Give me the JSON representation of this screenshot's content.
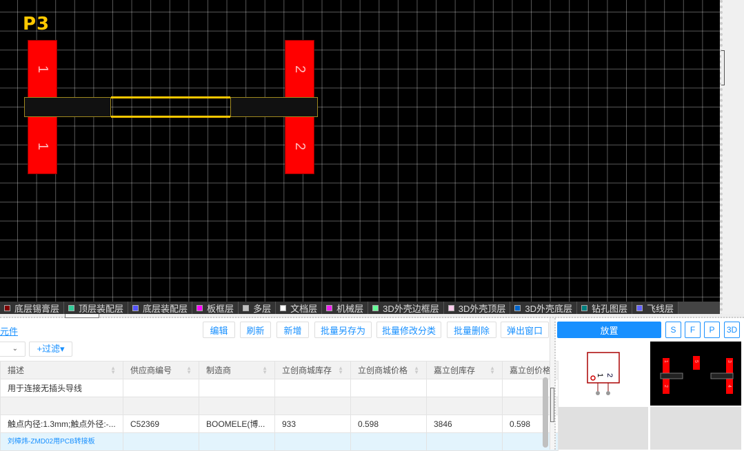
{
  "canvas": {
    "designator": "P3",
    "pads": [
      {
        "number": "1"
      },
      {
        "number": "1"
      },
      {
        "number": "2"
      },
      {
        "number": "2"
      }
    ]
  },
  "layers": [
    {
      "label": "底层锡膏层",
      "color": "#800000"
    },
    {
      "label": "顶层装配层",
      "color": "#33cc99"
    },
    {
      "label": "底层装配层",
      "color": "#5555ff"
    },
    {
      "label": "板框层",
      "color": "#ff00ff"
    },
    {
      "label": "多层",
      "color": "#c0c0c0"
    },
    {
      "label": "文档层",
      "color": "#ffffff"
    },
    {
      "label": "机械层",
      "color": "#f022f0"
    },
    {
      "label": "3D外壳边框层",
      "color": "#66ff99"
    },
    {
      "label": "3D外壳顶层",
      "color": "#ffccee"
    },
    {
      "label": "3D外壳底层",
      "color": "#0066cc"
    },
    {
      "label": "钻孔图层",
      "color": "#008080"
    },
    {
      "label": "飞线层",
      "color": "#6464ff"
    }
  ],
  "library": {
    "link": "元件",
    "toolbar": [
      "编辑",
      "刷新",
      "新增",
      "批量另存为",
      "批量修改分类",
      "批量删除",
      "弹出窗口"
    ],
    "select_arrow": "⌄",
    "filter": "+过滤▾",
    "columns": [
      "描述",
      "供应商编号",
      "制造商",
      "立创商城库存",
      "立创商城价格",
      "嘉立创库存",
      "嘉立创价格"
    ],
    "rows": [
      [
        "用于连接无插头导线",
        "",
        "",
        "",
        "",
        "",
        ""
      ],
      [
        "",
        "",
        "",
        "",
        "",
        "",
        ""
      ],
      [
        "触点内径:1.3mm;触点外径:-...",
        "C52369",
        "BOOMELE(博...",
        "933",
        "0.598",
        "3846",
        "0.598"
      ],
      [
        "刘樟炜-ZMD02用PCB转接板",
        "",
        "",
        "",
        "",
        "",
        ""
      ]
    ]
  },
  "preview": {
    "place": "放置",
    "modes": [
      "S",
      "F",
      "P",
      "3D"
    ],
    "symbol_pins": [
      "1",
      "2"
    ],
    "footprint_pads": [
      "1",
      "2",
      "3",
      "4",
      "5"
    ]
  }
}
